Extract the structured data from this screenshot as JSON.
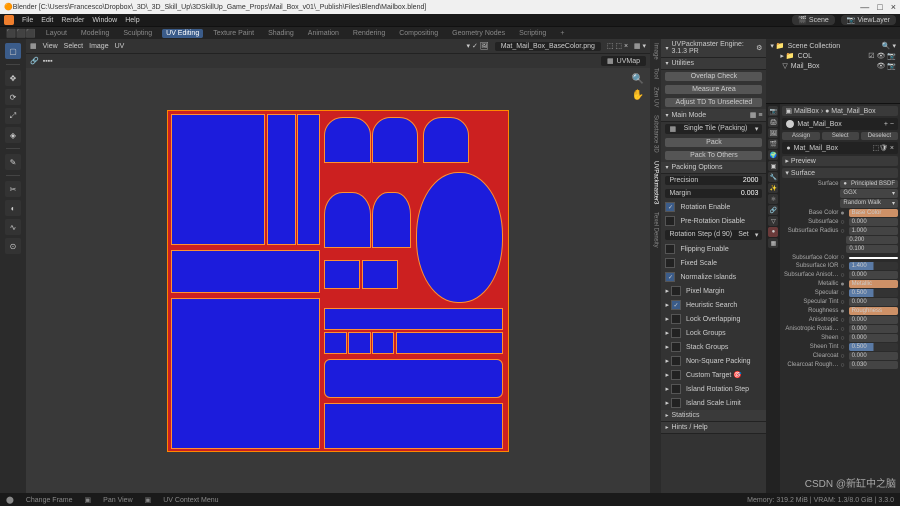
{
  "window": {
    "title": "Blender [C:\\Users\\Francesco\\Dropbox\\_3D\\_3D_Skill_Up\\3DSkillUp_Game_Props\\Mail_Box_v01\\_Publish\\Files\\Blend\\Mailbox.blend]",
    "btn_min": "—",
    "btn_max": "□",
    "btn_close": "×"
  },
  "menu": {
    "items": [
      "File",
      "Edit",
      "Render",
      "Window",
      "Help"
    ],
    "scene_label": "Scene",
    "viewlayer_label": "ViewLayer"
  },
  "workspaces": [
    "Layout",
    "Modeling",
    "Sculpting",
    "UV Editing",
    "Texture Paint",
    "Shading",
    "Animation",
    "Rendering",
    "Compositing",
    "Geometry Nodes",
    "Scripting"
  ],
  "workspace_active": 3,
  "uvheader": {
    "menus": [
      "View",
      "Select",
      "Image",
      "UV"
    ],
    "image": "Mat_Mail_Box_BaseColor.png",
    "uvmap_label": "UVMap"
  },
  "uvpack": {
    "title": "UVPackmaster Engine: 3.1.3 PR",
    "utilities": "Utilities",
    "overlap": "Overlap Check",
    "measure": "Measure Area",
    "adjust": "Adjust TD To Unselected",
    "mainmode": "Main Mode",
    "tile": "Single Tile (Packing)",
    "pack": "Pack",
    "packto": "Pack To Others",
    "packopts": "Packing Options",
    "precision_lbl": "Precision",
    "precision": "2000",
    "margin_lbl": "Margin",
    "margin": "0.003",
    "rotenable": "Rotation Enable",
    "prerot": "Pre-Rotation Disable",
    "rotstep_lbl": "Rotation Step (d   90)",
    "rotstep_btn": "Set",
    "flip": "Flipping Enable",
    "fixed": "Fixed Scale",
    "normalize": "Normalize Islands",
    "pixmargin": "Pixel Margin",
    "heuristic": "Heuristic Search",
    "lockover": "Lock Overlapping",
    "lockgroups": "Lock Groups",
    "stackgroups": "Stack Groups",
    "nonsquare": "Non-Square Packing",
    "custom": "Custom Target ",
    "islandrot": "Island Rotation Step",
    "islandscale": "Island Scale Limit",
    "stats": "Statistics",
    "hints": "Hints / Help"
  },
  "sidetabs": [
    "Image",
    "Tool",
    "Zen UV",
    "Substance 3D",
    "UVPackmaster3",
    "Texel Density"
  ],
  "outliner": {
    "scene": "Scene Collection",
    "coll": "COL",
    "obj": "Mail_Box"
  },
  "props": {
    "breadcrumb_obj": "MailBox",
    "breadcrumb_mat": "Mat_Mail_Box",
    "material": "Mat_Mail_Box",
    "assign": "Assign",
    "select": "Select",
    "deselect": "Deselect",
    "matname": "Mat_Mail_Box",
    "preview": "Preview",
    "surface": "Surface",
    "surface_lbl": "Surface",
    "surface_val": "Principled BSDF",
    "dist": "GGX",
    "sss_method": "Random Walk",
    "basecolor_lbl": "Base Color",
    "basecolor_val": "Base Color",
    "subsurface_lbl": "Subsurface",
    "subsurface": "0.000",
    "subsurfrad_lbl": "Subsurface Radius",
    "subsurfrad": [
      "1.000",
      "0.200",
      "0.100"
    ],
    "subsurfcol_lbl": "Subsurface Color",
    "subsurfior_lbl": "Subsurface IOR",
    "subsurfior": "1.400",
    "subsurfaniso_lbl": "Subsurface Anisot…",
    "subsurfaniso": "0.000",
    "metallic_lbl": "Metallic",
    "metallic_val": "Metallic",
    "specular_lbl": "Specular",
    "specular": "0.500",
    "spectint_lbl": "Specular Tint",
    "spectint": "0.000",
    "roughness_lbl": "Roughness",
    "roughness_val": "Roughness",
    "aniso_lbl": "Anisotropic",
    "aniso": "0.000",
    "anisorot_lbl": "Anisotropic Rotati…",
    "anisorot": "0.000",
    "sheen_lbl": "Sheen",
    "sheen": "0.000",
    "sheentint_lbl": "Sheen Tint",
    "sheentint": "0.500",
    "clearcoat_lbl": "Clearcoat",
    "clearcoat": "0.000",
    "clearrough_lbl": "Clearcoat Rough…",
    "clearrough": "0.030"
  },
  "status": {
    "change": "Change Frame",
    "pan": "Pan View",
    "context": "UV Context Menu",
    "version": "3.3.0",
    "mem": "Memory: 319.2 MiB | VRAM: 1.3/8.0 GiB |"
  },
  "watermark": "CSDN @新缸中之脑"
}
